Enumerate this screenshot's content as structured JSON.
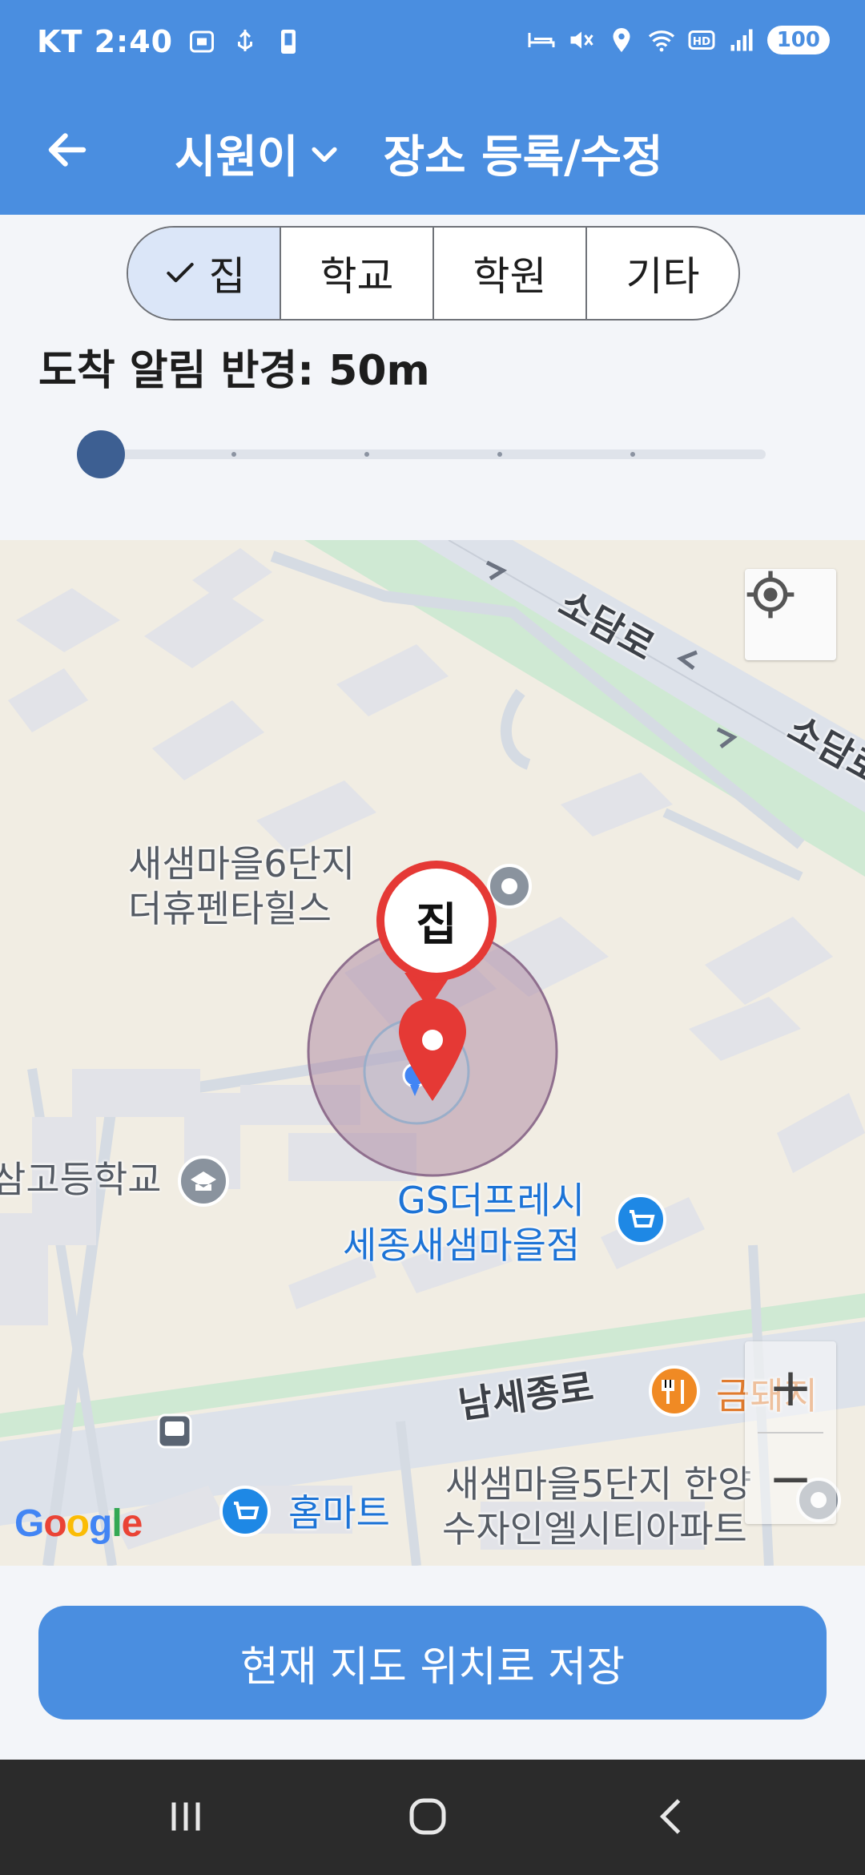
{
  "status_bar": {
    "carrier_time": "KT 2:40",
    "battery": "100",
    "icons_left": [
      "screenshot-icon",
      "usb-icon",
      "device-icon"
    ],
    "icons_right": [
      "bed-icon",
      "mute-icon",
      "location-icon",
      "wifi-icon",
      "hd-icon",
      "signal-icon"
    ]
  },
  "header": {
    "back_icon": "arrow-left-icon",
    "child_name": "시원이",
    "dropdown_icon": "chevron-down-icon",
    "title": "장소 등록/수정"
  },
  "place_types": {
    "selected_index": 0,
    "items": [
      {
        "label": "집"
      },
      {
        "label": "학교"
      },
      {
        "label": "학원"
      },
      {
        "label": "기타"
      }
    ]
  },
  "radius": {
    "label": "도착 알림 반경: 50m",
    "slider_steps": 5,
    "slider_value_index": 0
  },
  "map": {
    "marker_label": "집",
    "road_labels": {
      "sodam_1": "소담로",
      "sodam_2": "소담로",
      "namsejong": "남세종로"
    },
    "places": {
      "apt6": "새샘마을6단지\n더휴펜타힐스",
      "school": "삼고등학교",
      "gs_line1": "GS더프레시",
      "gs_line2": "세종새샘마을점",
      "restaurant": "금돼지",
      "homemart": "홈마트",
      "apt5_line1": "새샘마을5단지 한양",
      "apt5_line2": "수자인엘시티아파트"
    },
    "my_location_icon": "crosshair-icon",
    "zoom_in": "+",
    "zoom_out": "−",
    "attribution": "Google"
  },
  "actions": {
    "save_label": "현재 지도 위치로 저장"
  },
  "nav": {
    "recent_icon": "recent-apps-icon",
    "home_icon": "home-icon",
    "back_icon": "nav-back-icon"
  },
  "colors": {
    "primary": "#4a8ee0",
    "marker": "#e53935",
    "slider_thumb": "#3d5f92",
    "segment_selected": "#dbe6f8"
  }
}
